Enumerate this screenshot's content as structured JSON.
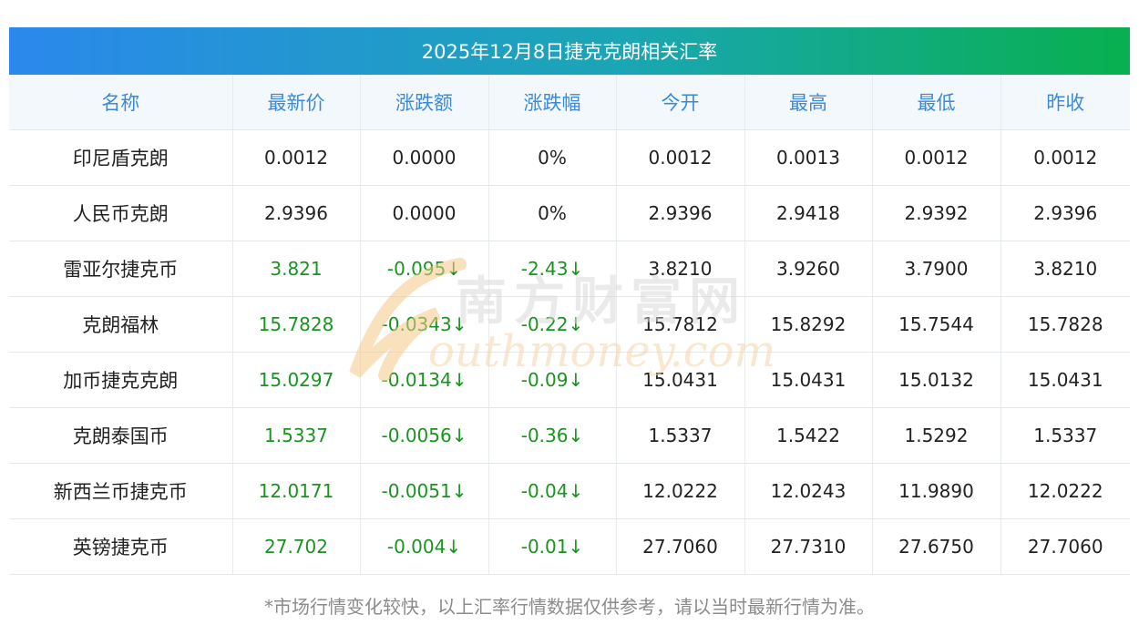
{
  "title": "2025年12月8日捷克克朗相关汇率",
  "columns": [
    "名称",
    "最新价",
    "涨跌额",
    "涨跌幅",
    "今开",
    "最高",
    "最低",
    "昨收"
  ],
  "rows": [
    {
      "name": "印尼盾克朗",
      "latest": "0.0012",
      "change": "0.0000",
      "pct": "0%",
      "open": "0.0012",
      "high": "0.0013",
      "low": "0.0012",
      "prev": "0.0012",
      "trend": "flat"
    },
    {
      "name": "人民币克朗",
      "latest": "2.9396",
      "change": "0.0000",
      "pct": "0%",
      "open": "2.9396",
      "high": "2.9418",
      "low": "2.9392",
      "prev": "2.9396",
      "trend": "flat"
    },
    {
      "name": "雷亚尔捷克币",
      "latest": "3.821",
      "change": "-0.095↓",
      "pct": "-2.43↓",
      "open": "3.8210",
      "high": "3.9260",
      "low": "3.7900",
      "prev": "3.8210",
      "trend": "down"
    },
    {
      "name": "克朗福林",
      "latest": "15.7828",
      "change": "-0.0343↓",
      "pct": "-0.22↓",
      "open": "15.7812",
      "high": "15.8292",
      "low": "15.7544",
      "prev": "15.7828",
      "trend": "down"
    },
    {
      "name": "加币捷克克朗",
      "latest": "15.0297",
      "change": "-0.0134↓",
      "pct": "-0.09↓",
      "open": "15.0431",
      "high": "15.0431",
      "low": "15.0132",
      "prev": "15.0431",
      "trend": "down"
    },
    {
      "name": "克朗泰国币",
      "latest": "1.5337",
      "change": "-0.0056↓",
      "pct": "-0.36↓",
      "open": "1.5337",
      "high": "1.5422",
      "low": "1.5292",
      "prev": "1.5337",
      "trend": "down"
    },
    {
      "name": "新西兰币捷克币",
      "latest": "12.0171",
      "change": "-0.0051↓",
      "pct": "-0.04↓",
      "open": "12.0222",
      "high": "12.0243",
      "low": "11.9890",
      "prev": "12.0222",
      "trend": "down"
    },
    {
      "name": "英镑捷克币",
      "latest": "27.702",
      "change": "-0.004↓",
      "pct": "-0.01↓",
      "open": "27.7060",
      "high": "27.7310",
      "low": "27.6750",
      "prev": "27.7060",
      "trend": "down"
    }
  ],
  "footnote": "*市场行情变化较快，以上汇率行情数据仅供参考，请以当时最新行情为准。",
  "watermark": {
    "cn": "南方财富网",
    "en": "outhmoney.com"
  },
  "colors": {
    "header_start": "#2b88ec",
    "header_end": "#08b04e",
    "down": "#18941f",
    "column_header_text": "#3b8ad8"
  }
}
